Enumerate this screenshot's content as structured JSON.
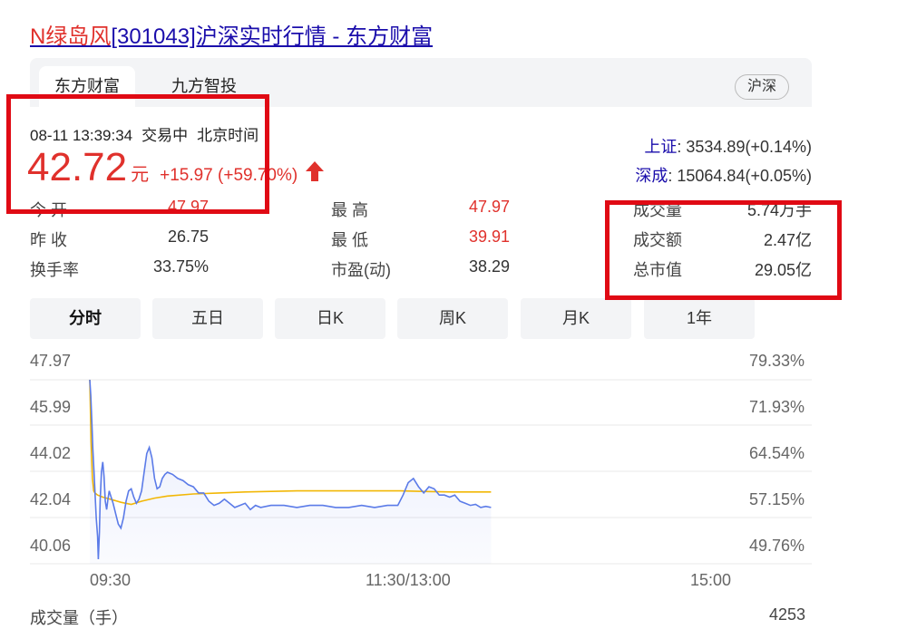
{
  "page_title": {
    "name": "N绿岛风",
    "rest": "[301043]沪深实时行情 - 东方财富"
  },
  "source_tabs": [
    {
      "label": "东方财富",
      "active": true
    },
    {
      "label": "九方智投",
      "active": false
    }
  ],
  "market_label": "沪深",
  "quote": {
    "datetime": "08-11 13:39:34",
    "trade_status": "交易中",
    "timezone": "北京时间",
    "price": "42.72",
    "unit": "元",
    "change": "+15.97 (+59.70%)",
    "direction": "up"
  },
  "indices": [
    {
      "name": "上证",
      "value": ": 3534.89(+0.14%)"
    },
    {
      "name": "深成",
      "value": ": 15064.84(+0.05%)"
    }
  ],
  "stats": {
    "open_label": "今 开",
    "open": "47.97",
    "prev_close_label": "昨 收",
    "prev_close": "26.75",
    "turnover_label": "换手率",
    "turnover": "33.75%",
    "high_label": "最 高",
    "high": "47.97",
    "low_label": "最 低",
    "low": "39.91",
    "pe_label": "市盈(动)",
    "pe": "38.29",
    "volume_label": "成交量",
    "volume": "5.74万手",
    "amount_label": "成交额",
    "amount": "2.47亿",
    "mktcap_label": "总市值",
    "mktcap": "29.05亿"
  },
  "period_tabs": [
    {
      "label": "分时",
      "active": true
    },
    {
      "label": "五日",
      "active": false
    },
    {
      "label": "日K",
      "active": false
    },
    {
      "label": "周K",
      "active": false
    },
    {
      "label": "月K",
      "active": false
    },
    {
      "label": "1年",
      "active": false
    }
  ],
  "colors": {
    "accent_red": "#e0312c",
    "price_line": "#5b7be8",
    "avg_line": "#f2b705",
    "highlight_box": "#e00a14"
  },
  "chart_data": {
    "type": "line",
    "y_ticks": [
      "47.97",
      "45.99",
      "44.02",
      "42.04",
      "40.06"
    ],
    "y_pct_ticks": [
      "79.33%",
      "71.93%",
      "64.54%",
      "57.15%",
      "49.76%"
    ],
    "ylim": [
      39.08,
      47.97
    ],
    "x_ticks": [
      "09:30",
      "11:30/13:00",
      "15:00"
    ],
    "x_range_minutes": [
      0,
      240
    ],
    "grid": true,
    "series": [
      {
        "values": [
          [
            0,
            47.97
          ],
          [
            0.4,
            47.2
          ],
          [
            0.8,
            45.9
          ],
          [
            1.2,
            44.6
          ],
          [
            1.7,
            43.3
          ],
          [
            2.1,
            42.3
          ],
          [
            2.5,
            41.3
          ],
          [
            3.0,
            40.4
          ],
          [
            3.3,
            39.3
          ],
          [
            3.7,
            40.6
          ],
          [
            4.0,
            42.1
          ],
          [
            4.5,
            43.5
          ],
          [
            5.0,
            44.0
          ],
          [
            5.5,
            43.3
          ],
          [
            6.0,
            42.1
          ],
          [
            6.5,
            41.7
          ],
          [
            7.0,
            42.2
          ],
          [
            7.5,
            42.6
          ],
          [
            8.0,
            42.4
          ],
          [
            9.0,
            42.0
          ],
          [
            10.0,
            41.5
          ],
          [
            11.0,
            41.0
          ],
          [
            12.0,
            40.8
          ],
          [
            13.0,
            41.3
          ],
          [
            14.0,
            42.1
          ],
          [
            15.0,
            42.6
          ],
          [
            16.0,
            42.7
          ],
          [
            17.0,
            42.3
          ],
          [
            18.0,
            42.0
          ],
          [
            19.0,
            42.2
          ],
          [
            20.0,
            42.6
          ],
          [
            21.0,
            43.5
          ],
          [
            22.0,
            44.4
          ],
          [
            23.0,
            44.7
          ],
          [
            24.0,
            44.2
          ],
          [
            25.0,
            43.2
          ],
          [
            26.0,
            42.7
          ],
          [
            27.0,
            42.8
          ],
          [
            28.0,
            43.2
          ],
          [
            29.0,
            43.4
          ],
          [
            30.0,
            43.5
          ],
          [
            32.0,
            43.4
          ],
          [
            34.0,
            43.2
          ],
          [
            36.0,
            43.1
          ],
          [
            38.0,
            42.9
          ],
          [
            40.0,
            42.8
          ],
          [
            42.0,
            42.5
          ],
          [
            44.0,
            42.5
          ],
          [
            46.0,
            42.1
          ],
          [
            48.0,
            41.9
          ],
          [
            50.0,
            42.0
          ],
          [
            52.0,
            42.2
          ],
          [
            54.0,
            42.0
          ],
          [
            56.0,
            41.8
          ],
          [
            58.0,
            41.9
          ],
          [
            60.0,
            42.0
          ],
          [
            62.0,
            41.7
          ],
          [
            64.0,
            41.9
          ],
          [
            66.0,
            41.8
          ],
          [
            70.0,
            41.9
          ],
          [
            75.0,
            41.9
          ],
          [
            80.0,
            41.8
          ],
          [
            85.0,
            41.9
          ],
          [
            90.0,
            41.9
          ],
          [
            95.0,
            41.8
          ],
          [
            100.0,
            41.8
          ],
          [
            105.0,
            41.9
          ],
          [
            110.0,
            41.8
          ],
          [
            115.0,
            41.9
          ],
          [
            119.0,
            41.9
          ],
          [
            121.0,
            42.4
          ],
          [
            123.0,
            43.0
          ],
          [
            125.0,
            43.2
          ],
          [
            127.0,
            42.8
          ],
          [
            129.0,
            42.5
          ],
          [
            131.0,
            42.8
          ],
          [
            133.0,
            42.7
          ],
          [
            135.0,
            42.4
          ],
          [
            137.0,
            42.4
          ],
          [
            139.0,
            42.3
          ],
          [
            141.0,
            42.4
          ],
          [
            143.0,
            42.1
          ],
          [
            145.0,
            42.0
          ],
          [
            147.0,
            41.9
          ],
          [
            149.0,
            41.95
          ],
          [
            151.0,
            41.8
          ],
          [
            153.0,
            41.85
          ],
          [
            155.0,
            41.8
          ]
        ]
      },
      {
        "values": [
          [
            0,
            47.97
          ],
          [
            0.5,
            45.0
          ],
          [
            1.0,
            43.2
          ],
          [
            1.5,
            42.6
          ],
          [
            2.0,
            42.5
          ],
          [
            3.0,
            42.4
          ],
          [
            5.0,
            42.3
          ],
          [
            8.0,
            42.2
          ],
          [
            12.0,
            42.05
          ],
          [
            16.0,
            41.95
          ],
          [
            20.0,
            42.1
          ],
          [
            25.0,
            42.25
          ],
          [
            30.0,
            42.35
          ],
          [
            40.0,
            42.45
          ],
          [
            50.0,
            42.5
          ],
          [
            60.0,
            42.55
          ],
          [
            80.0,
            42.6
          ],
          [
            100.0,
            42.6
          ],
          [
            120.0,
            42.6
          ],
          [
            130.0,
            42.57
          ],
          [
            140.0,
            42.55
          ],
          [
            155.0,
            42.55
          ]
        ]
      }
    ]
  },
  "volume_label": "成交量（手）",
  "volume_max": "4253"
}
